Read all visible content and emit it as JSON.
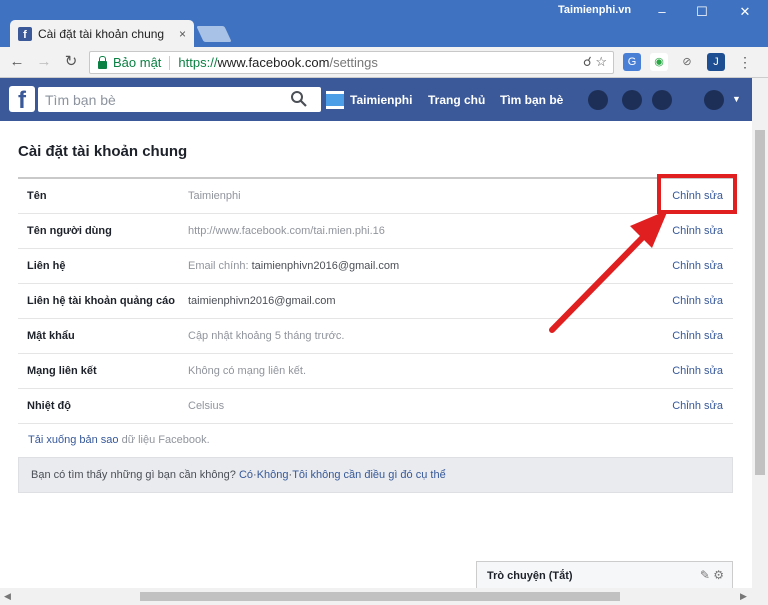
{
  "browser": {
    "tab_title": "Cài đặt tài khoản chung",
    "tab_close": "×",
    "brand": "Taimienphi.vn",
    "secure_label": "Bảo mật",
    "url_proto": "https://",
    "url_host": "www.facebook.com",
    "url_path": "/settings"
  },
  "fb": {
    "logo": "f",
    "search_placeholder": "Tìm bạn bè",
    "user_name": "Taimienphi",
    "nav_home": "Trang chủ",
    "nav_find_friends": "Tìm bạn bè"
  },
  "settings": {
    "title": "Cài đặt tài khoản chung",
    "rows": [
      {
        "label": "Tên",
        "value": "Taimienphi",
        "edit": "Chỉnh sửa"
      },
      {
        "label": "Tên người dùng",
        "value": "http://www.facebook.com/tai.mien.phi.16",
        "edit": "Chỉnh sửa"
      },
      {
        "label": "Liên hệ",
        "value_prefix": "Email chính: ",
        "value": "taimienphivn2016@gmail.com",
        "edit": "Chỉnh sửa"
      },
      {
        "label": "Liên hệ tài khoản quảng cáo",
        "value": "taimienphivn2016@gmail.com",
        "edit": "Chỉnh sửa"
      },
      {
        "label": "Mật khẩu",
        "value": "Cập nhật khoảng 5 tháng trước.",
        "edit": "Chỉnh sửa"
      },
      {
        "label": "Mạng liên kết",
        "value": "Không có mạng liên kết.",
        "edit": "Chỉnh sửa"
      },
      {
        "label": "Nhiệt độ",
        "value": "Celsius",
        "edit": "Chỉnh sửa"
      }
    ],
    "download_link": "Tải xuống bản sao",
    "download_rest": " dữ liệu Facebook.",
    "help_question": "Bạn có tìm thấy những gì bạn cần không?",
    "help_yes": "Có",
    "help_no": "Không",
    "help_none": "Tôi không cần điều gì đó cụ thể",
    "help_sep": " · "
  },
  "chat": {
    "label": "Trò chuyện (Tắt)"
  },
  "colors": {
    "fb_blue": "#3b5998",
    "link": "#365899",
    "annotation_red": "#e02020"
  }
}
